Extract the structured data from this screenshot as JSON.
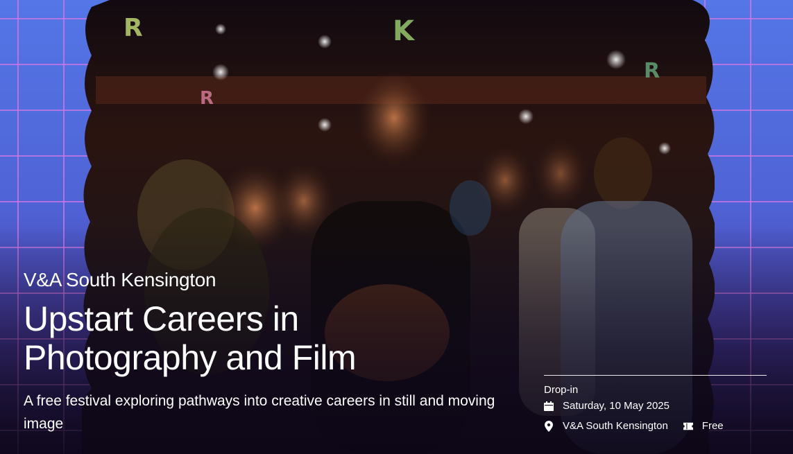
{
  "brand": {
    "logo_text": "V&A South Kensington"
  },
  "event": {
    "title": "Upstart Careers in Photography and Film",
    "subtitle": "A free festival exploring pathways into creative careers in still and moving image",
    "type": "Drop-in",
    "date": "Saturday, 10 May 2025",
    "location": "V&A South Kensington",
    "price": "Free"
  },
  "icons": {
    "date": "calendar-icon",
    "location": "location-pin-icon",
    "price": "ticket-icon"
  },
  "colors": {
    "grid_background": "#4a62d8",
    "grid_lines": "#d278e6",
    "text": "#ffffff"
  }
}
